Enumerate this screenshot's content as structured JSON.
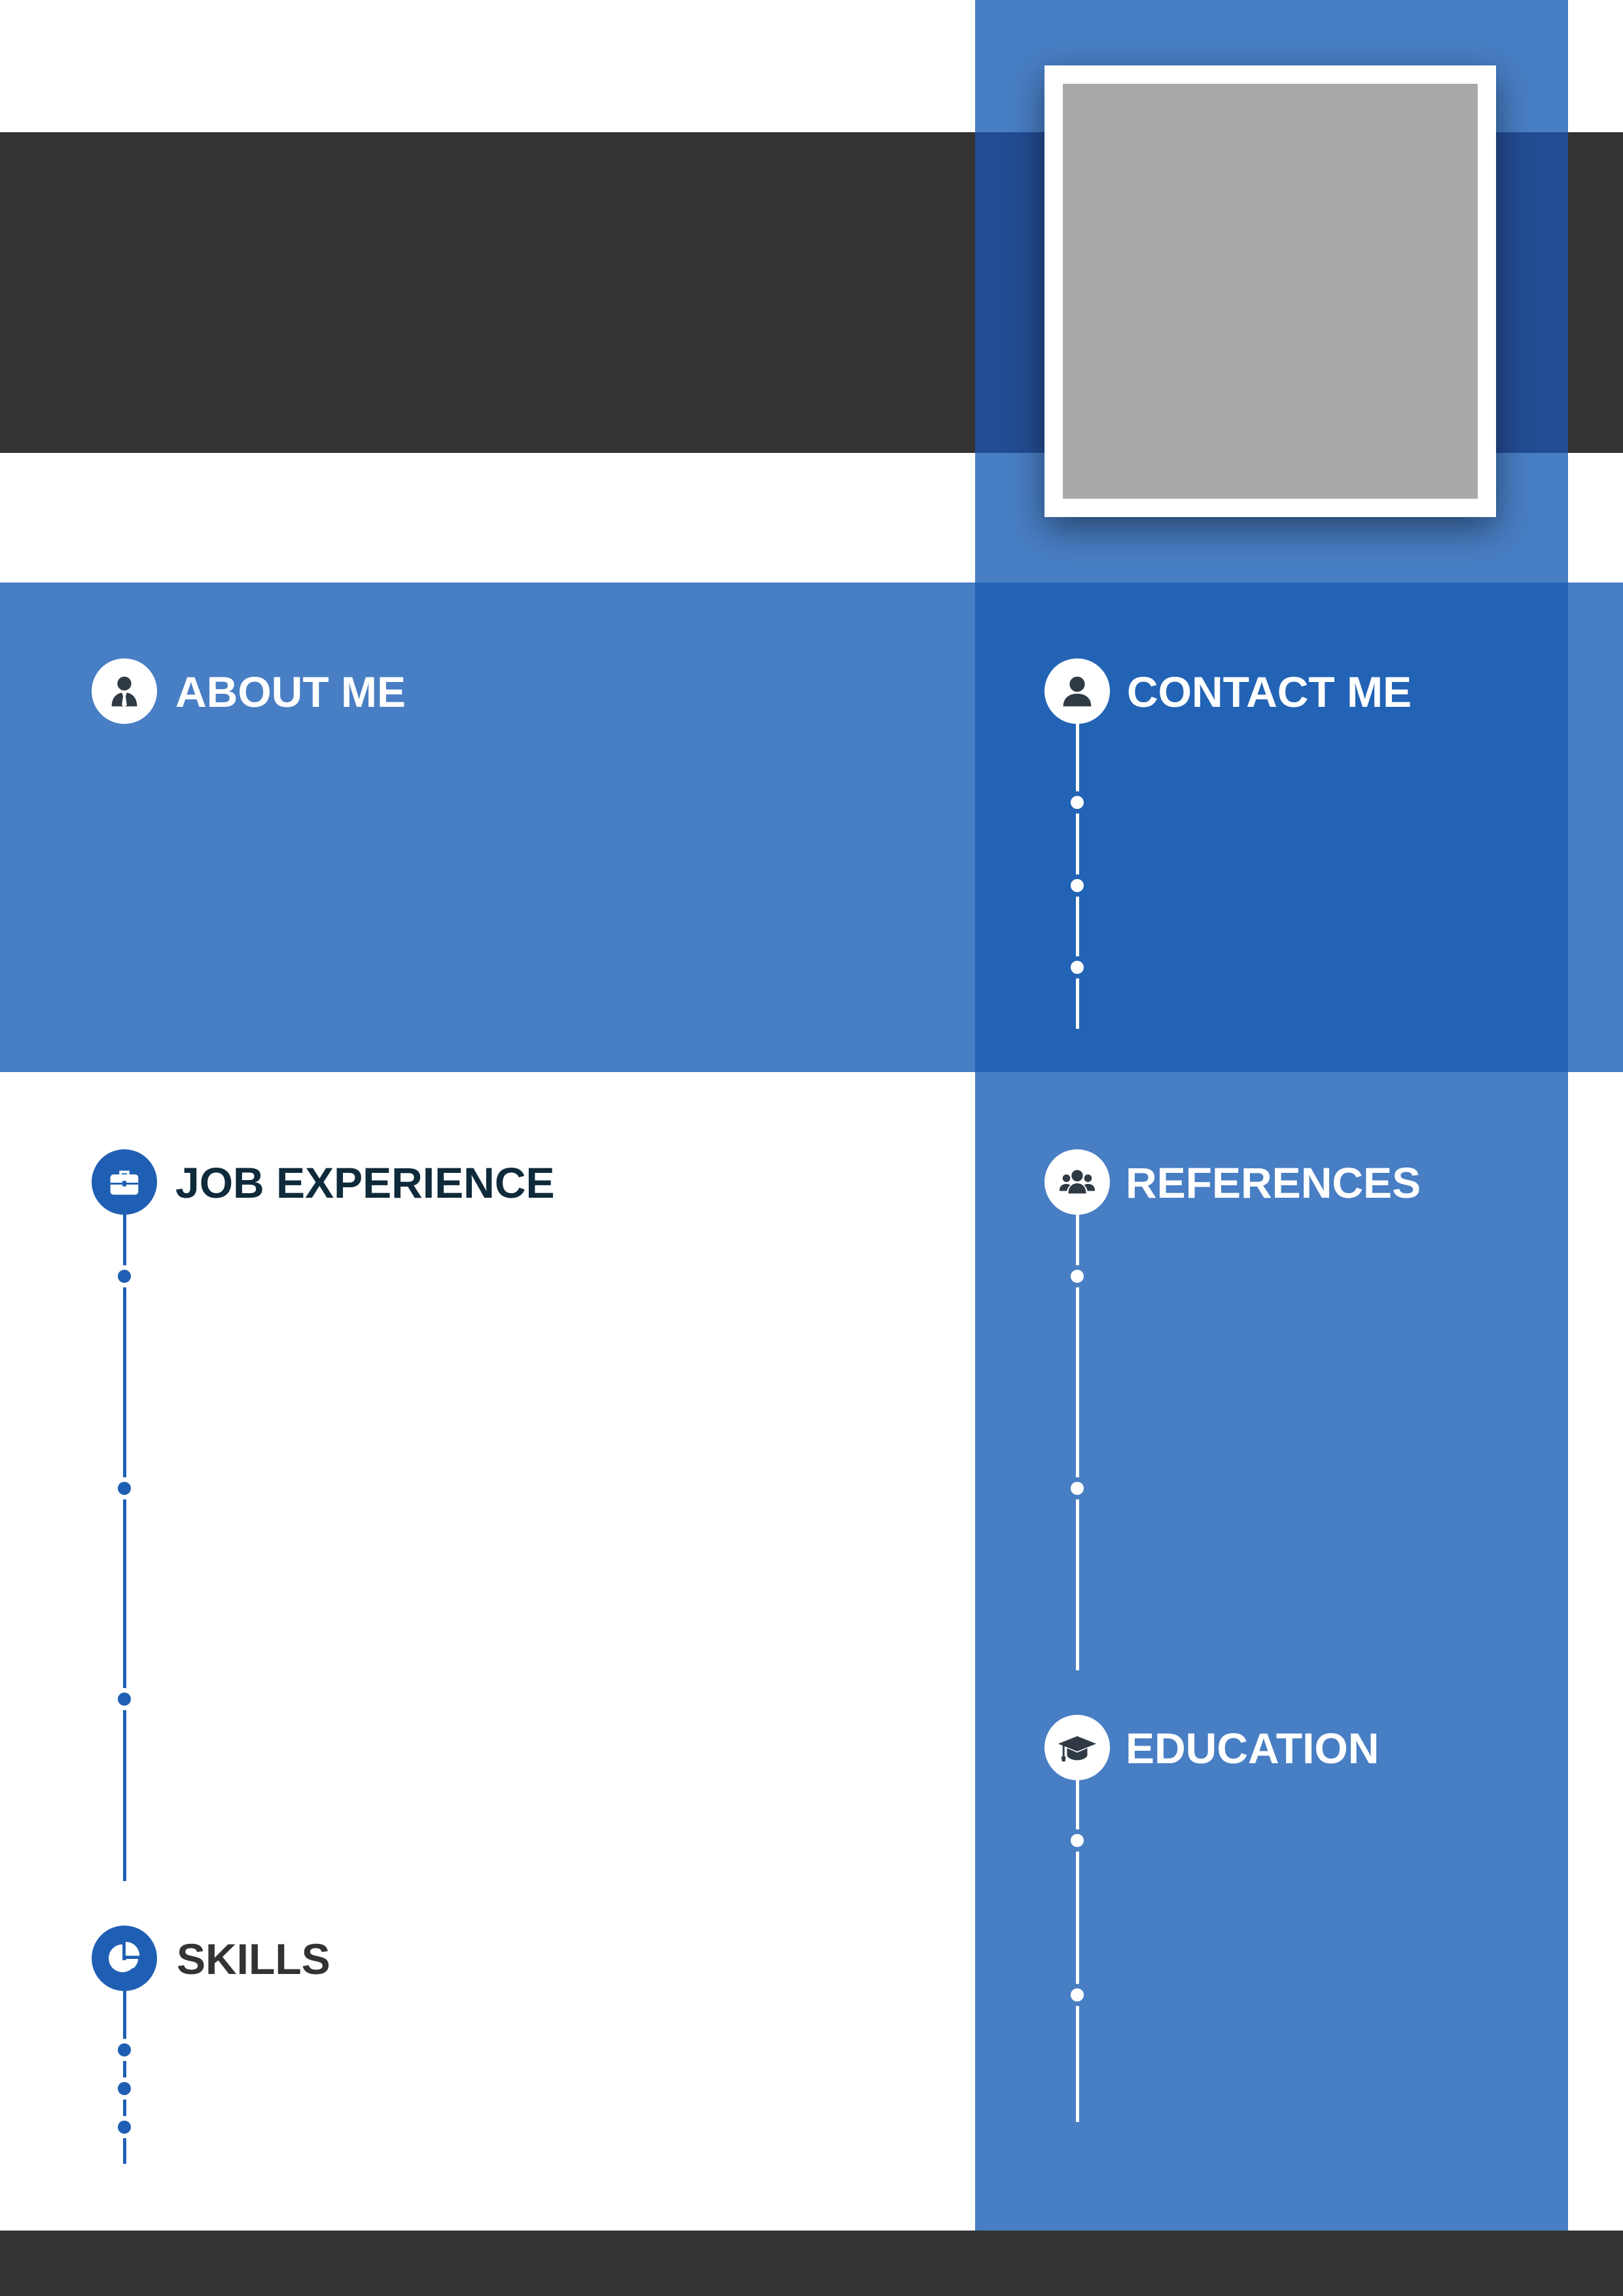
{
  "colors": {
    "accent_blue": "#487ec4",
    "deep_blue": "#2263b5",
    "icon_blue": "#1f5fb3",
    "dark_band": "#333333",
    "heading_dark": "#0f2a3a",
    "photo_placeholder": "#a9a9a9"
  },
  "sections": {
    "about": {
      "title": "ABOUT ME",
      "icon": "user-tie-icon"
    },
    "contact": {
      "title": "CONTACT ME",
      "icon": "user-icon"
    },
    "job": {
      "title": "JOB EXPERIENCE",
      "icon": "briefcase-icon"
    },
    "references": {
      "title": "REFERENCES",
      "icon": "users-icon"
    },
    "education": {
      "title": "EDUCATION",
      "icon": "graduation-cap-icon"
    },
    "skills": {
      "title": "SKILLS",
      "icon": "pie-chart-icon"
    }
  }
}
